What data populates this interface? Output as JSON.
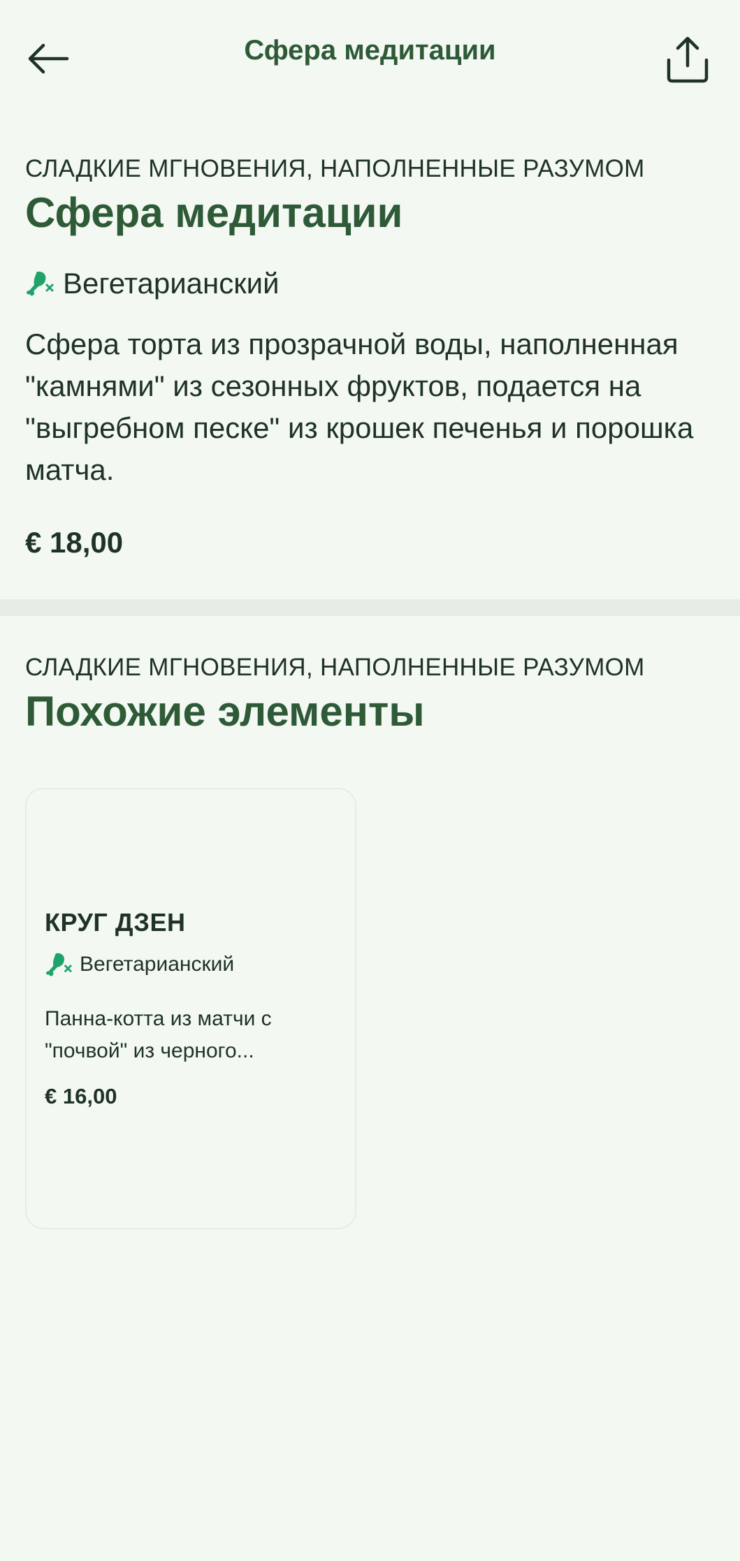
{
  "header": {
    "title": "Сфера медитации"
  },
  "item": {
    "category": "СЛАДКИЕ МГНОВЕНИЯ, НАПОЛНЕННЫЕ РАЗУМОМ",
    "name": "Сфера медитации",
    "diet": "Вегетарианский",
    "diet_icon": "vegetarian-drumstick-icon",
    "description": "Сфера торта из прозрачной воды, наполненная \"камнями\" из сезонных фруктов, подается на \"выгребном песке\" из крошек печенья и порошка матча.",
    "price": "€ 18,00"
  },
  "similar": {
    "category": "СЛАДКИЕ МГНОВЕНИЯ, НАПОЛНЕННЫЕ РАЗУМОМ",
    "title": "Похожие элементы",
    "items": [
      {
        "name": "КРУГ ДЗЕН",
        "diet": "Вегетарианский",
        "description": "Панна-котта из матчи с \"почвой\" из черного...",
        "price": "€ 16,00"
      }
    ]
  },
  "colors": {
    "background": "#f3f8f2",
    "accent_green": "#2e5a37",
    "text_dark": "#1f3324",
    "diet_icon_green": "#1fa36a",
    "divider": "#e6ece6"
  }
}
